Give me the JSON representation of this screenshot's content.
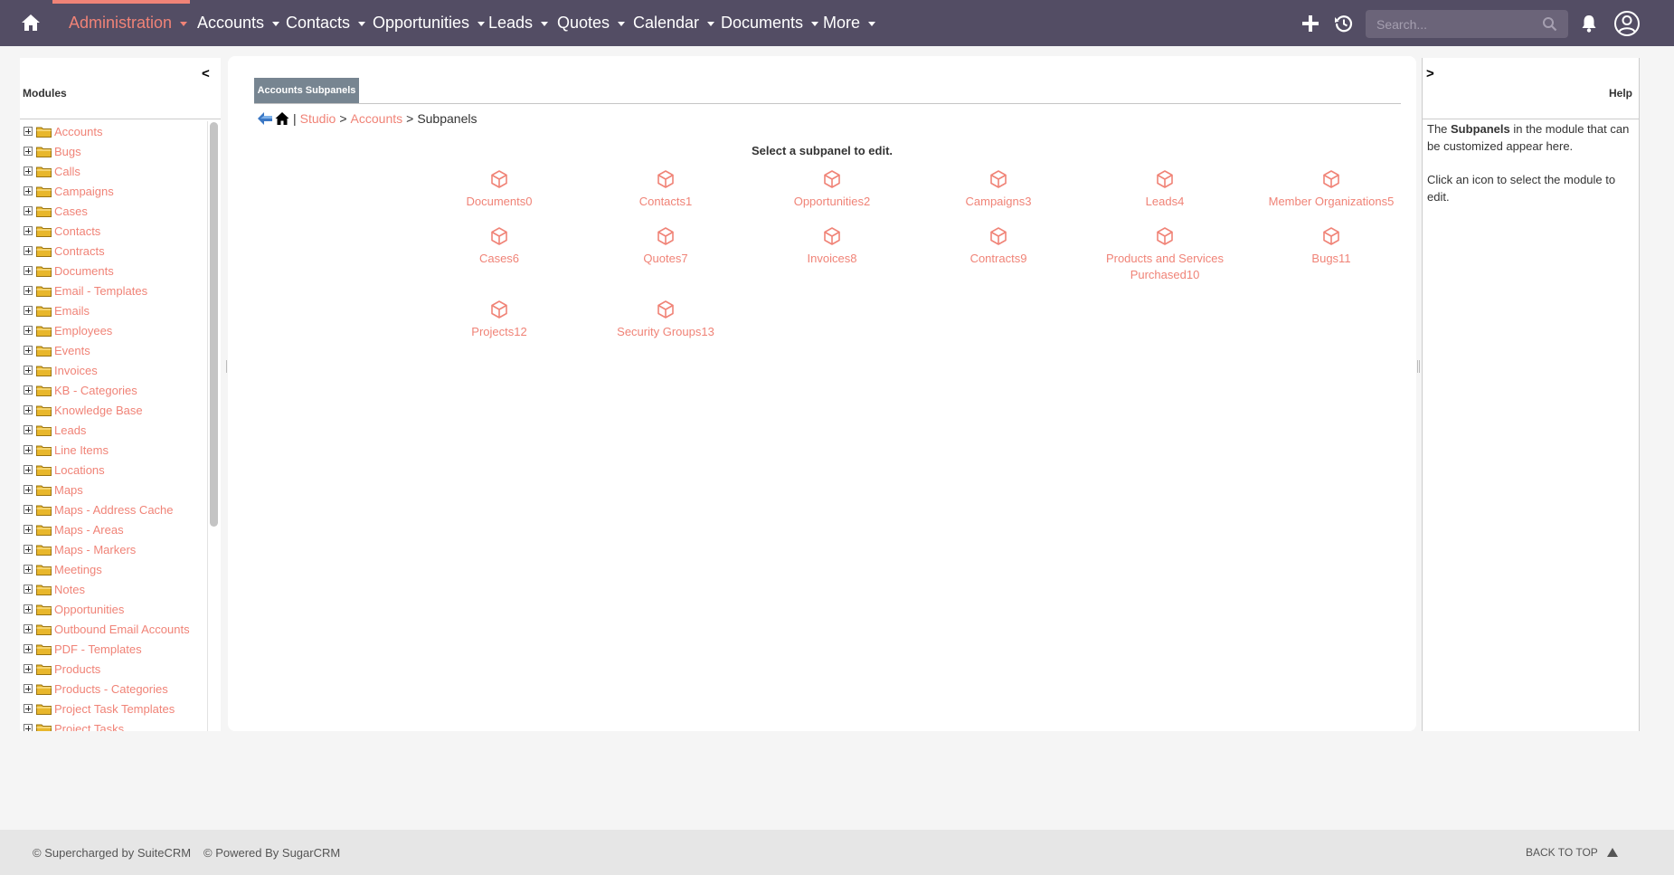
{
  "nav": {
    "items": [
      {
        "label": "Administration",
        "active": true
      },
      {
        "label": "Accounts"
      },
      {
        "label": "Contacts"
      },
      {
        "label": "Opportunities"
      },
      {
        "label": "Leads"
      },
      {
        "label": "Quotes"
      },
      {
        "label": "Calendar"
      },
      {
        "label": "Documents"
      },
      {
        "label": "More"
      }
    ],
    "search_placeholder": "Search...",
    "icons": [
      "home-icon",
      "plus-icon",
      "history-icon",
      "search-icon",
      "bell-icon",
      "user-icon"
    ]
  },
  "modules_panel": {
    "title": "Modules",
    "collapse_label": "<",
    "items": [
      "Accounts",
      "Bugs",
      "Calls",
      "Campaigns",
      "Cases",
      "Contacts",
      "Contracts",
      "Documents",
      "Email - Templates",
      "Emails",
      "Employees",
      "Events",
      "Invoices",
      "KB - Categories",
      "Knowledge Base",
      "Leads",
      "Line Items",
      "Locations",
      "Maps",
      "Maps - Address Cache",
      "Maps - Areas",
      "Maps - Markers",
      "Meetings",
      "Notes",
      "Opportunities",
      "Outbound Email Accounts",
      "PDF - Templates",
      "Products",
      "Products - Categories",
      "Project Task Templates",
      "Project Tasks"
    ]
  },
  "main": {
    "tab_label": "Accounts Subpanels",
    "breadcrumb": {
      "pipe": "|",
      "studio": "Studio",
      "sep": ">",
      "accounts": "Accounts",
      "current": "Subpanels"
    },
    "instruction": "Select a subpanel to edit.",
    "subpanels": [
      "Documents0",
      "Contacts1",
      "Opportunities2",
      "Campaigns3",
      "Leads4",
      "Member Organizations5",
      "Cases6",
      "Quotes7",
      "Invoices8",
      "Contracts9",
      "Products and Services Purchased10",
      "Bugs11",
      "Projects12",
      "Security Groups13"
    ]
  },
  "help_panel": {
    "title": "Help",
    "expand_label": ">",
    "text_before": "The ",
    "text_bold": "Subpanels",
    "text_after": " in the module that can be customized appear here.",
    "text_2": "Click an icon to select the module to edit."
  },
  "footer": {
    "suite": "© Supercharged by SuiteCRM",
    "sugar": "© Powered By SugarCRM",
    "back_to_top": "BACK TO TOP"
  },
  "colors": {
    "nav_bg": "#534d64",
    "accent": "#f08377",
    "tab_bg": "#778591"
  }
}
